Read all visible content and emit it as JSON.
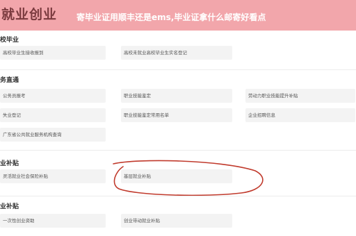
{
  "header": {
    "title": "就业创业",
    "headline": "寄毕业证用顺丰还是ems,毕业证拿什么邮寄好看点"
  },
  "sections": [
    {
      "title": "校毕业",
      "items": [
        "高校毕业生接收报到",
        "高校未就业高校毕业生实名登记"
      ]
    },
    {
      "title": "务直通",
      "items": [
        "公务员报考",
        "职业技能鉴定",
        "劳动力职业技能提升补贴",
        "失业登记",
        "职业技能鉴定常用名单",
        "企业招聘信息",
        "广东省公共就业服务机构查询"
      ]
    },
    {
      "title": "业补贴",
      "items": [
        "灵活就业社会保险补贴",
        "基层就业补贴"
      ]
    },
    {
      "title": "业补贴",
      "items": [
        "一次性创业资助",
        "创业带动就业补贴"
      ]
    }
  ],
  "colors": {
    "banner": "#f2a6ab",
    "annotation": "#c0392b"
  }
}
